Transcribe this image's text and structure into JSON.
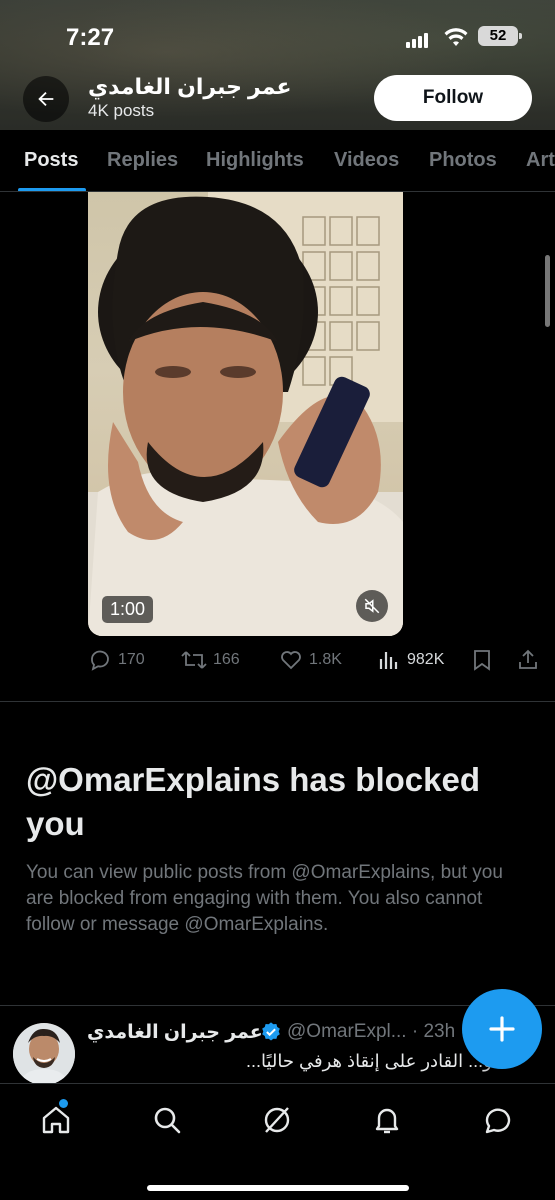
{
  "status_bar": {
    "time": "7:27",
    "battery": "52"
  },
  "header": {
    "name": "عمر جبران الغامدي",
    "posts_count": "4K posts",
    "follow_label": "Follow"
  },
  "tabs": [
    "Posts",
    "Replies",
    "Highlights",
    "Videos",
    "Photos",
    "Art"
  ],
  "video": {
    "duration": "1:00"
  },
  "actions": {
    "replies": "170",
    "reposts": "166",
    "likes": "1.8K",
    "views": "982K"
  },
  "blocked": {
    "title": "@OmarExplains has blocked you",
    "body": "You can view public posts from @OmarExplains, but you are blocked from engaging with them. You also cannot follow or message @OmarExplains."
  },
  "next_post": {
    "name": "عمر جبران الغامدي",
    "handle": "@OmarExpl...",
    "time": "· 23h",
    "text": "الو... القادر على إنقاذ هرفي حاليًا..."
  },
  "colors": {
    "accent": "#1d9bf0",
    "muted": "#71767b",
    "text": "#e7e9ea"
  }
}
